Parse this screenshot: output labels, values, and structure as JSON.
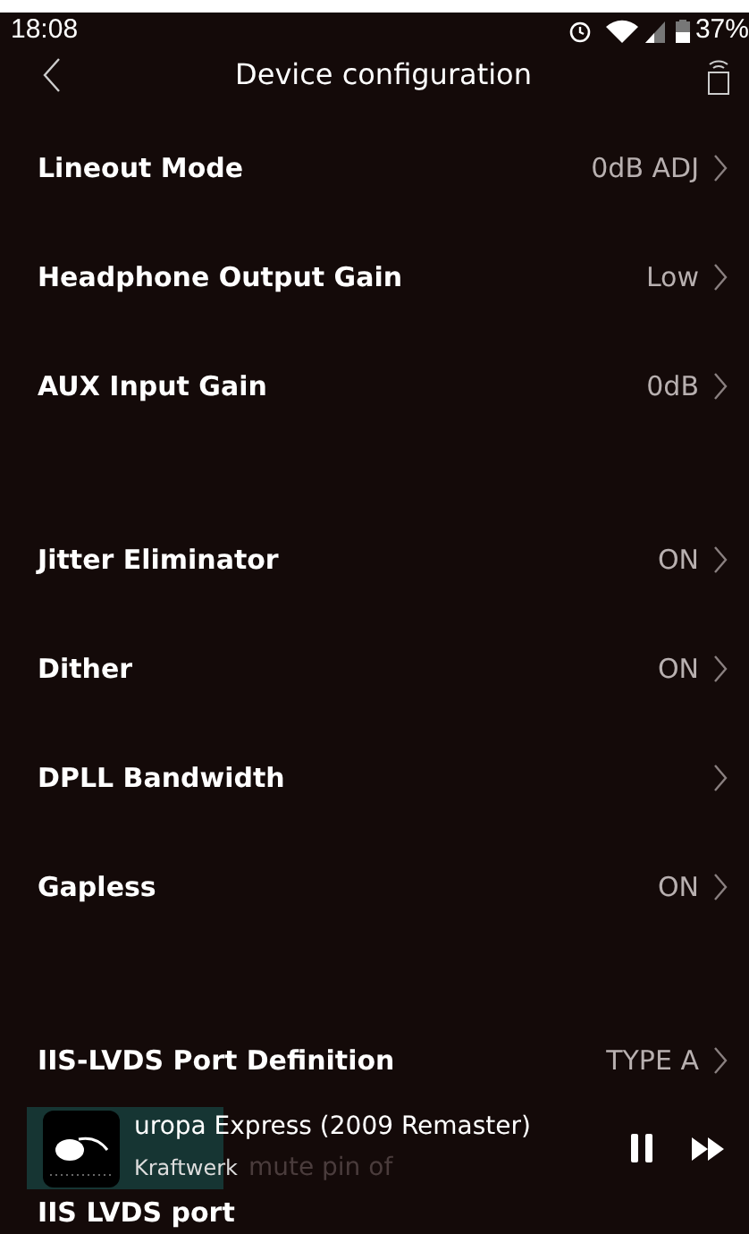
{
  "status_bar": {
    "time": "18:08",
    "battery": "37%"
  },
  "header": {
    "title": "Device configuration"
  },
  "groups": [
    {
      "rows": [
        {
          "label": "Lineout Mode",
          "value": "0dB ADJ"
        },
        {
          "label": "Headphone Output Gain",
          "value": "Low"
        },
        {
          "label": "AUX Input Gain",
          "value": "0dB"
        }
      ]
    },
    {
      "rows": [
        {
          "label": "Jitter Eliminator",
          "value": "ON"
        },
        {
          "label": "Dither",
          "value": "ON"
        },
        {
          "label": "DPLL Bandwidth"
        },
        {
          "label": "Gapless",
          "value": "ON"
        }
      ]
    },
    {
      "rows": [
        {
          "label": "IIS-LVDS Port Definition",
          "value": "TYPE A"
        }
      ]
    }
  ],
  "player": {
    "title": "uropa Express (2009 Remaster)",
    "artist": "Kraftwerk",
    "behind_text": "mute pin of"
  },
  "last_row": {
    "label": "IIS LVDS port"
  }
}
